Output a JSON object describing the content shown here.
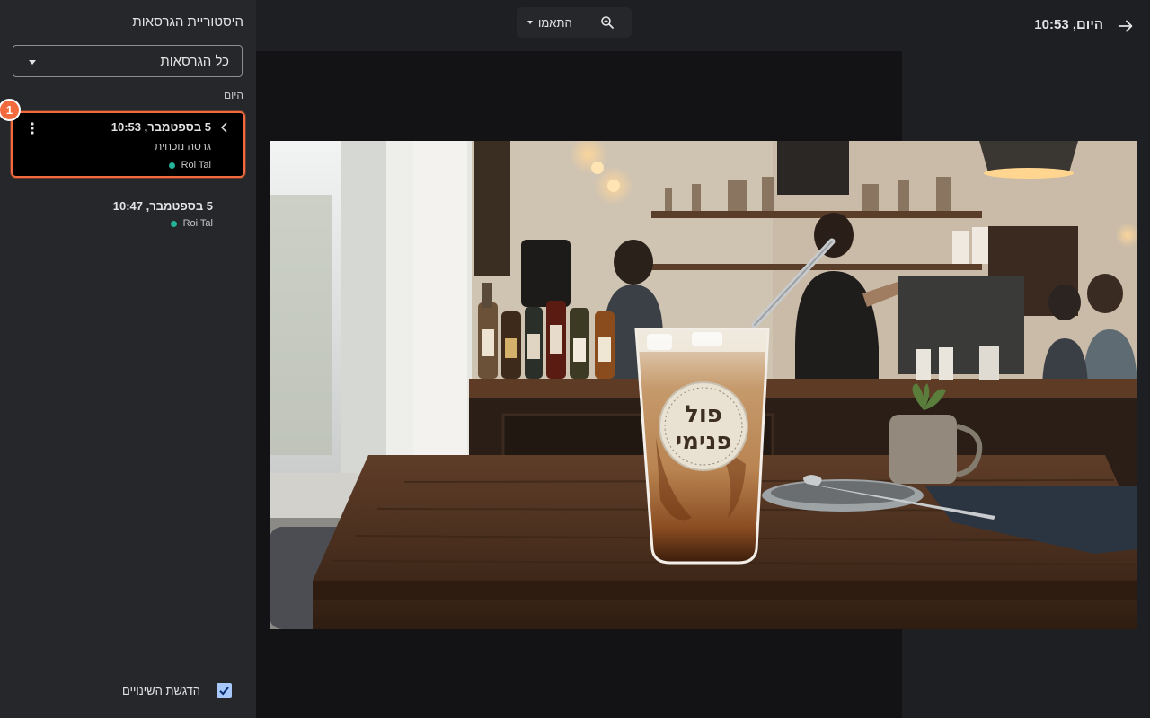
{
  "topbar": {
    "title": "היום, 10:53",
    "zoom_label": "התאמו"
  },
  "panel": {
    "title": "היסטוריית הגרסאות",
    "filter": "כל הגרסאות",
    "section": "היום",
    "versions": [
      {
        "date": "5 בספטמבר, 10:53",
        "label": "גרסה נוכחית",
        "author": "Roi Tal"
      },
      {
        "date": "5 בספטמבר, 10:47",
        "author": "Roi Tal"
      }
    ],
    "step_badge": "1",
    "highlight_changes": "הדגשת השינויים"
  },
  "image": {
    "cup_text_line1": "פול",
    "cup_text_line2": "פנימי"
  },
  "colors": {
    "accent": "#f26a3d",
    "author_dot": "#24b39a",
    "checkbox": "#a8c7fa"
  }
}
